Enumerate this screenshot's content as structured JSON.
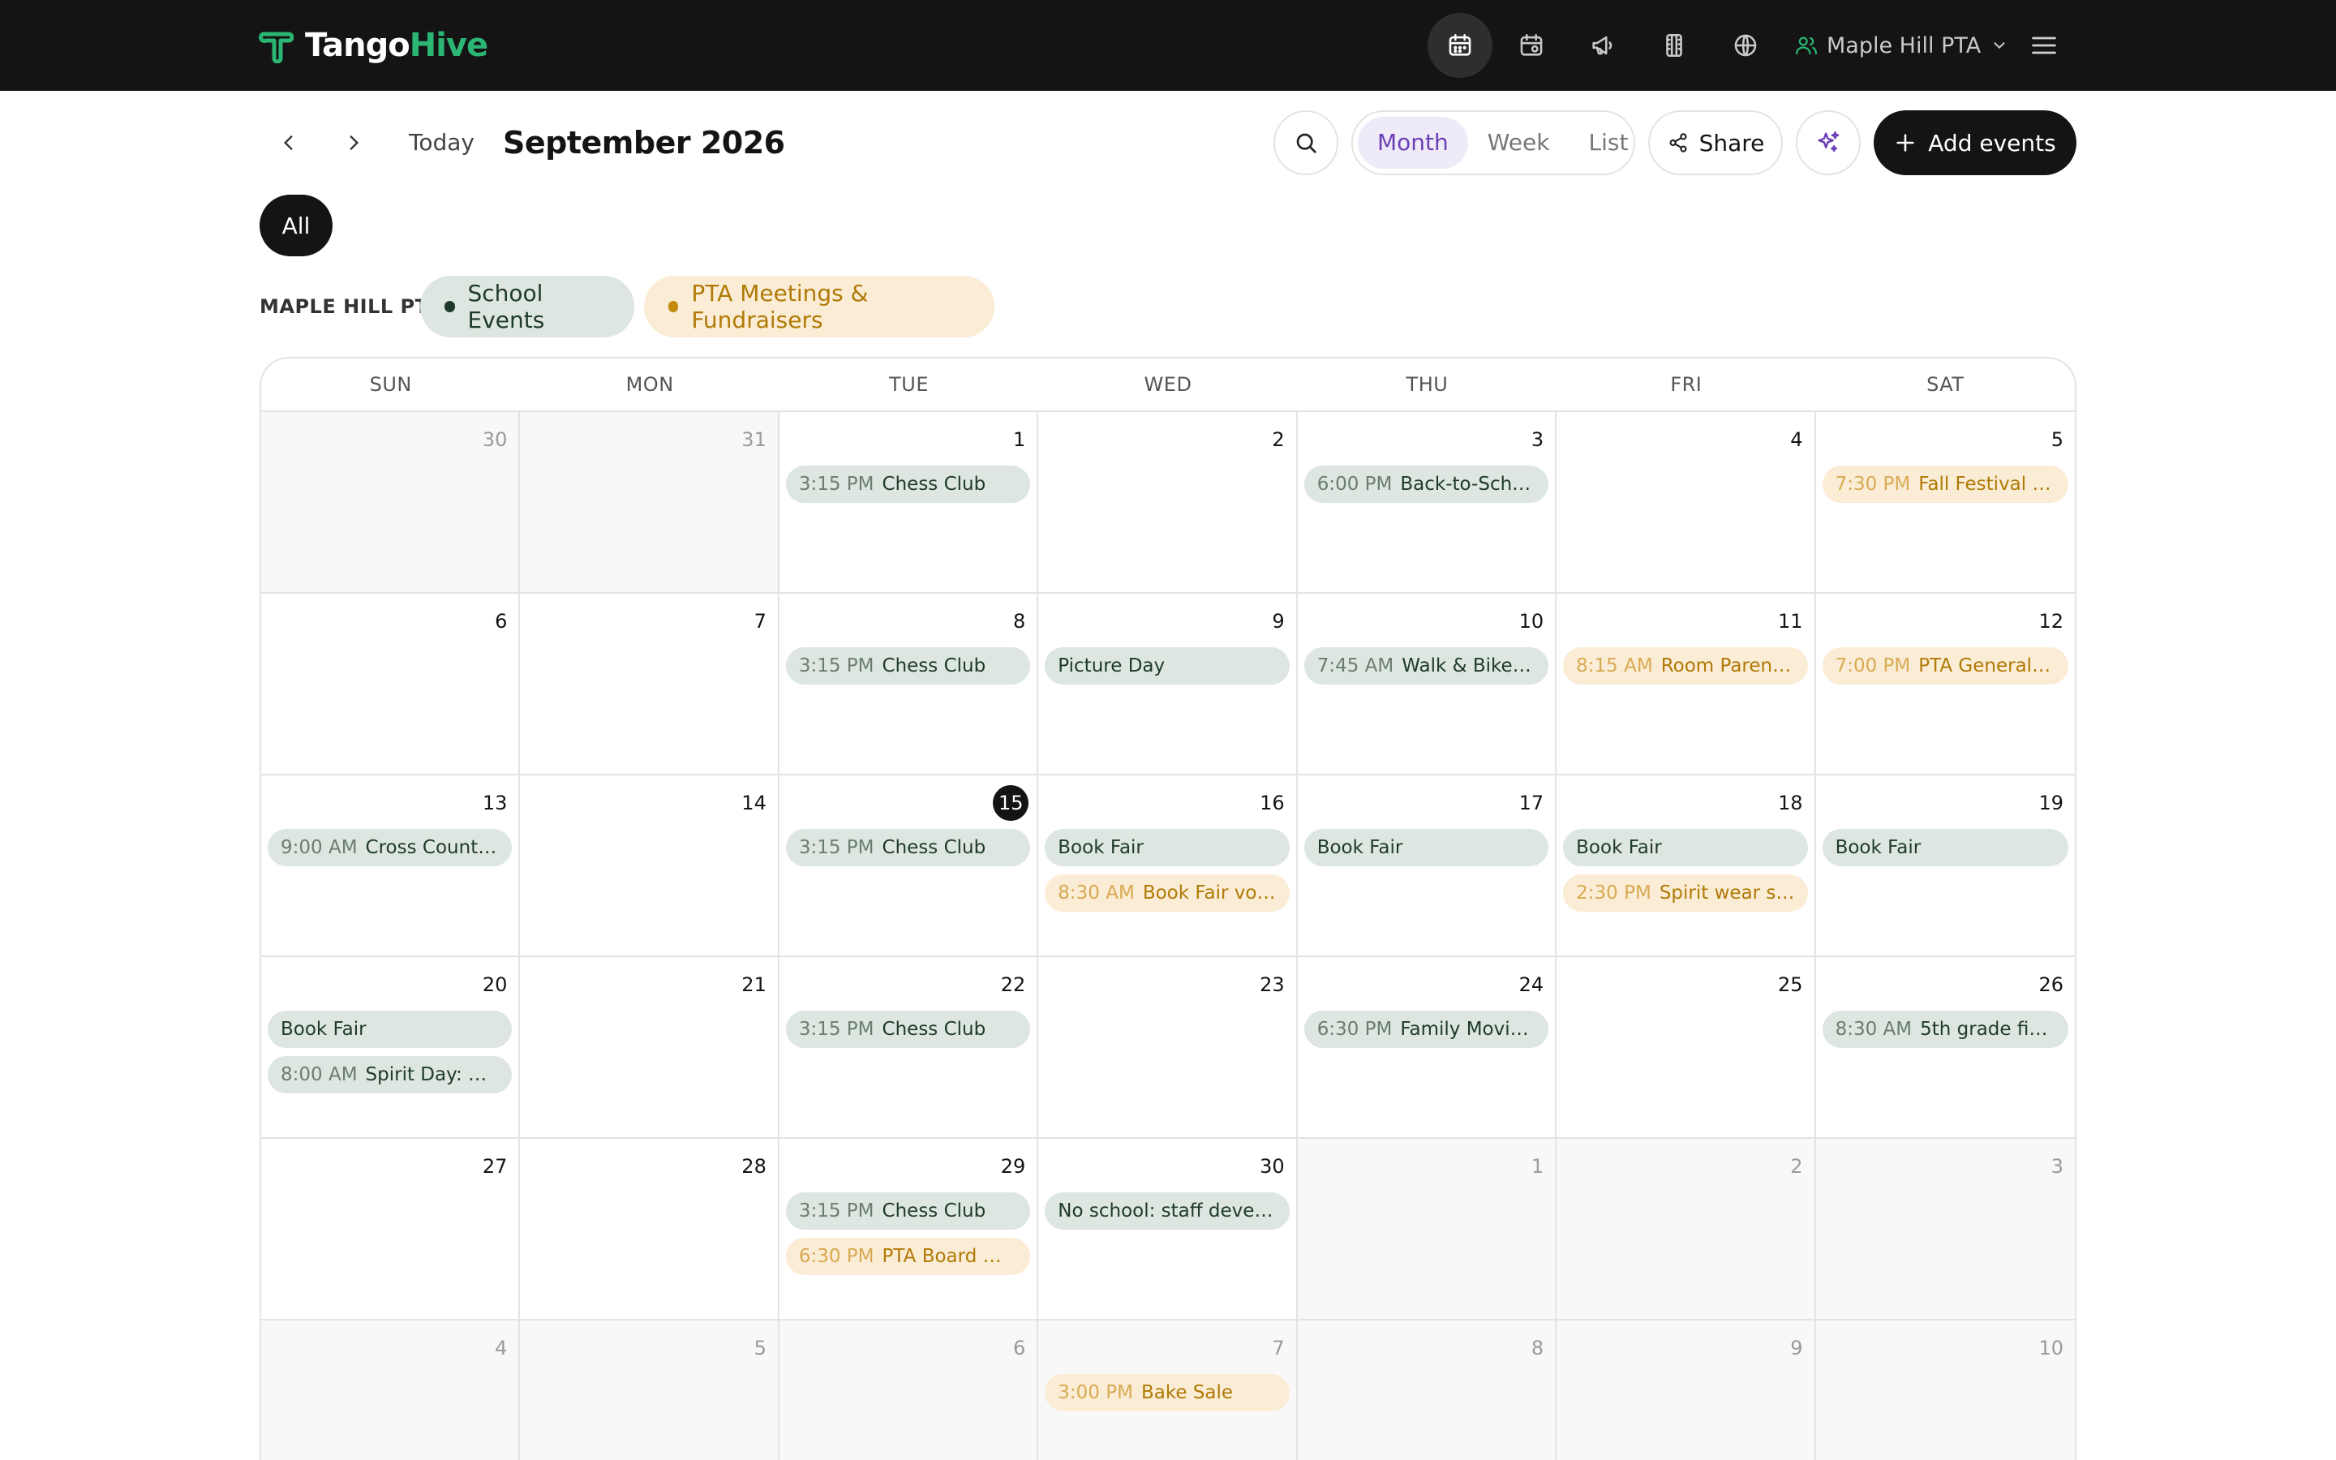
{
  "brand": {
    "name_part1": "Tango",
    "name_part2": "Hive",
    "accent": "#2bb673"
  },
  "nav": {
    "icons": [
      "calendar-icon",
      "calendar-event-icon",
      "megaphone-icon",
      "film-icon",
      "globe-icon"
    ],
    "org_name": "Maple Hill PTA"
  },
  "toolbar": {
    "today": "Today",
    "month_title": "September 2026",
    "views": [
      "Month",
      "Week",
      "List"
    ],
    "active_view": "Month",
    "share": "Share",
    "add_events": "Add events"
  },
  "filters": {
    "all": "All",
    "org_label": "MAPLE HILL PTA",
    "categories": [
      {
        "label": "School Events",
        "color": "#1f3a2a"
      },
      {
        "label": "PTA Meetings & Fundraisers",
        "color": "#c38a0c"
      }
    ]
  },
  "calendar": {
    "weekdays": [
      "SUN",
      "MON",
      "TUE",
      "WED",
      "THU",
      "FRI",
      "SAT"
    ],
    "today": 15,
    "cells": [
      {
        "day": "30",
        "muted": true,
        "events": []
      },
      {
        "day": "31",
        "muted": true,
        "events": []
      },
      {
        "day": "1",
        "events": [
          {
            "time": "3:15 PM",
            "title": "Chess Club",
            "cat": "school"
          }
        ]
      },
      {
        "day": "2",
        "events": []
      },
      {
        "day": "3",
        "events": [
          {
            "time": "6:00 PM",
            "title": "Back-to-Scho…",
            "cat": "school"
          }
        ]
      },
      {
        "day": "4",
        "events": []
      },
      {
        "day": "5",
        "events": [
          {
            "time": "7:30 PM",
            "title": "Fall Festival pla…",
            "cat": "pta"
          }
        ]
      },
      {
        "day": "6",
        "events": []
      },
      {
        "day": "7",
        "events": []
      },
      {
        "day": "8",
        "events": [
          {
            "time": "3:15 PM",
            "title": "Chess Club",
            "cat": "school"
          }
        ]
      },
      {
        "day": "9",
        "events": [
          {
            "time": "",
            "title": "Picture Day",
            "cat": "school"
          }
        ]
      },
      {
        "day": "10",
        "events": [
          {
            "time": "7:45 AM",
            "title": "Walk & Bike to …",
            "cat": "school"
          }
        ]
      },
      {
        "day": "11",
        "events": [
          {
            "time": "8:15 AM",
            "title": "Room Parent c…",
            "cat": "pta"
          }
        ]
      },
      {
        "day": "12",
        "events": [
          {
            "time": "7:00 PM",
            "title": "PTA General M…",
            "cat": "pta"
          }
        ]
      },
      {
        "day": "13",
        "events": [
          {
            "time": "9:00 AM",
            "title": "Cross Country …",
            "cat": "school"
          }
        ]
      },
      {
        "day": "14",
        "events": []
      },
      {
        "day": "15",
        "today": true,
        "events": [
          {
            "time": "3:15 PM",
            "title": "Chess Club",
            "cat": "school"
          }
        ]
      },
      {
        "day": "16",
        "events": [
          {
            "time": "",
            "title": "Book Fair",
            "cat": "school"
          },
          {
            "time": "8:30 AM",
            "title": "Book Fair volu…",
            "cat": "pta"
          }
        ]
      },
      {
        "day": "17",
        "events": [
          {
            "time": "",
            "title": "Book Fair",
            "cat": "school"
          }
        ]
      },
      {
        "day": "18",
        "events": [
          {
            "time": "",
            "title": "Book Fair",
            "cat": "school"
          },
          {
            "time": "2:30 PM",
            "title": "Spirit wear sale",
            "cat": "pta"
          }
        ]
      },
      {
        "day": "19",
        "events": [
          {
            "time": "",
            "title": "Book Fair",
            "cat": "school"
          }
        ]
      },
      {
        "day": "20",
        "events": [
          {
            "time": "",
            "title": "Book Fair",
            "cat": "school"
          },
          {
            "time": "8:00 AM",
            "title": "Spirit Day: wea…",
            "cat": "school"
          }
        ]
      },
      {
        "day": "21",
        "events": []
      },
      {
        "day": "22",
        "events": [
          {
            "time": "3:15 PM",
            "title": "Chess Club",
            "cat": "school"
          }
        ]
      },
      {
        "day": "23",
        "events": []
      },
      {
        "day": "24",
        "events": [
          {
            "time": "6:30 PM",
            "title": "Family Movie N…",
            "cat": "school"
          }
        ]
      },
      {
        "day": "25",
        "events": []
      },
      {
        "day": "26",
        "events": [
          {
            "time": "8:30 AM",
            "title": "5th grade field …",
            "cat": "school"
          }
        ]
      },
      {
        "day": "27",
        "events": []
      },
      {
        "day": "28",
        "events": []
      },
      {
        "day": "29",
        "events": [
          {
            "time": "3:15 PM",
            "title": "Chess Club",
            "cat": "school"
          },
          {
            "time": "6:30 PM",
            "title": "PTA Board me…",
            "cat": "pta"
          }
        ]
      },
      {
        "day": "30",
        "events": [
          {
            "time": "",
            "title": "No school: staff develo…",
            "cat": "school"
          }
        ]
      },
      {
        "day": "1",
        "muted": true,
        "events": []
      },
      {
        "day": "2",
        "muted": true,
        "events": []
      },
      {
        "day": "3",
        "muted": true,
        "events": []
      },
      {
        "day": "4",
        "muted": true,
        "events": []
      },
      {
        "day": "5",
        "muted": true,
        "events": []
      },
      {
        "day": "6",
        "muted": true,
        "events": []
      },
      {
        "day": "7",
        "muted": true,
        "events": [
          {
            "time": "3:00 PM",
            "title": "Bake Sale",
            "cat": "pta"
          }
        ]
      },
      {
        "day": "8",
        "muted": true,
        "events": []
      },
      {
        "day": "9",
        "muted": true,
        "events": []
      },
      {
        "day": "10",
        "muted": true,
        "events": []
      }
    ]
  }
}
